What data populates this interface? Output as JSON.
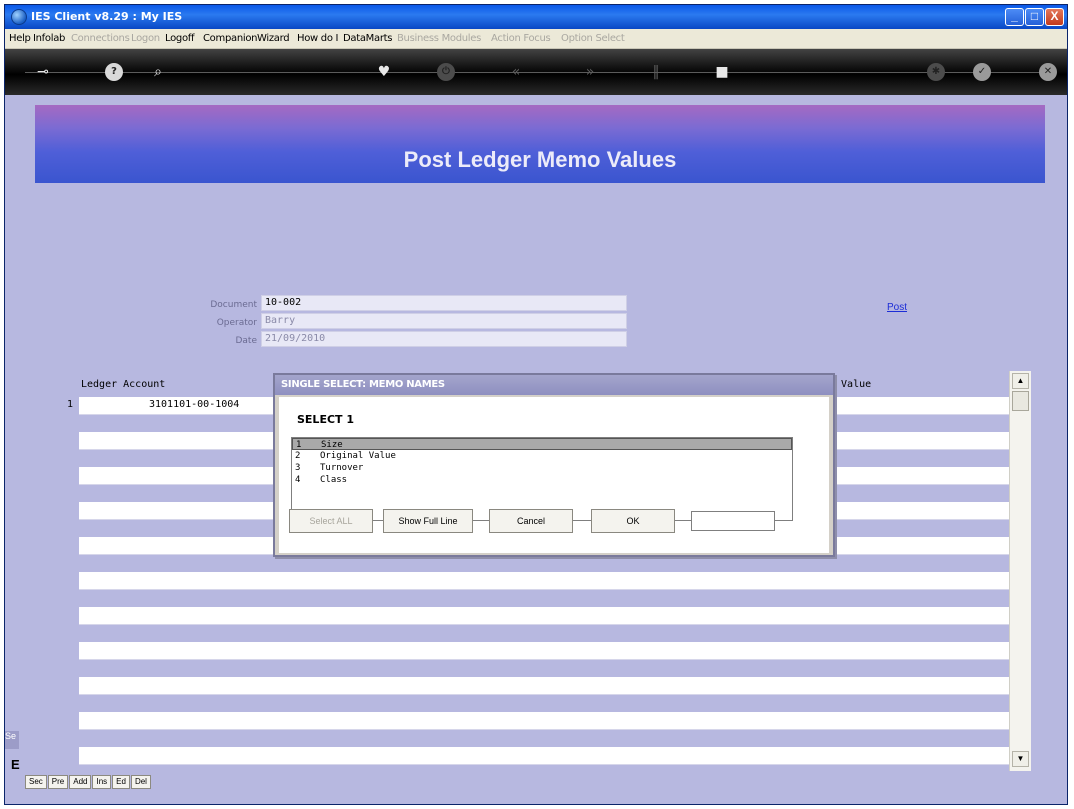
{
  "window": {
    "title": "IES Client v8.29 : My IES",
    "minimize": "_",
    "maximize": "□",
    "close": "X"
  },
  "menu": [
    {
      "label": "Help",
      "enabled": true
    },
    {
      "label": "Infolab",
      "enabled": true
    },
    {
      "label": "Connections",
      "enabled": false
    },
    {
      "label": "Logon",
      "enabled": false
    },
    {
      "label": "Logoff",
      "enabled": true
    },
    {
      "label": "Companion",
      "enabled": true
    },
    {
      "label": "Wizard",
      "enabled": true
    },
    {
      "label": "How do I",
      "enabled": true
    },
    {
      "label": "DataMarts",
      "enabled": true
    },
    {
      "label": "Business Modules",
      "enabled": false
    },
    {
      "label": "Action Focus",
      "enabled": false
    },
    {
      "label": "Option Select",
      "enabled": false
    }
  ],
  "toolbar_icons": [
    "key-icon",
    "help-icon",
    "search-icon",
    "heart-icon",
    "power-icon",
    "rewind-icon",
    "fast-forward-icon",
    "pause-icon",
    "stop-icon",
    "settings-icon",
    "check-icon",
    "close-icon"
  ],
  "banner": {
    "title": "Post Ledger Memo Values"
  },
  "header": {
    "document_label": "Document",
    "document_value": "10-002",
    "operator_label": "Operator",
    "operator_value": "Barry",
    "date_label": "Date",
    "date_value": "21/09/2010",
    "post_link": "Post"
  },
  "grid": {
    "col_account": "Ledger Account",
    "col_value": "w Value",
    "rows": [
      {
        "num": "1",
        "account": "3101101-00-1004"
      }
    ],
    "buttons": [
      "Sec",
      "Pre",
      "Add",
      "Ins",
      "Ed",
      "Del"
    ],
    "side_tab": "Se",
    "side_mark": "E"
  },
  "dialog": {
    "title": "SINGLE SELECT: MEMO NAMES",
    "caption": "SELECT 1",
    "items": [
      {
        "num": "1",
        "label": "Size",
        "selected": true
      },
      {
        "num": "2",
        "label": "Original Value",
        "selected": false
      },
      {
        "num": "3",
        "label": "Turnover",
        "selected": false
      },
      {
        "num": "4",
        "label": "Class",
        "selected": false
      }
    ],
    "buttons": {
      "select_all": "Select ALL",
      "show_full_line": "Show Full Line",
      "cancel": "Cancel",
      "ok": "OK"
    }
  }
}
